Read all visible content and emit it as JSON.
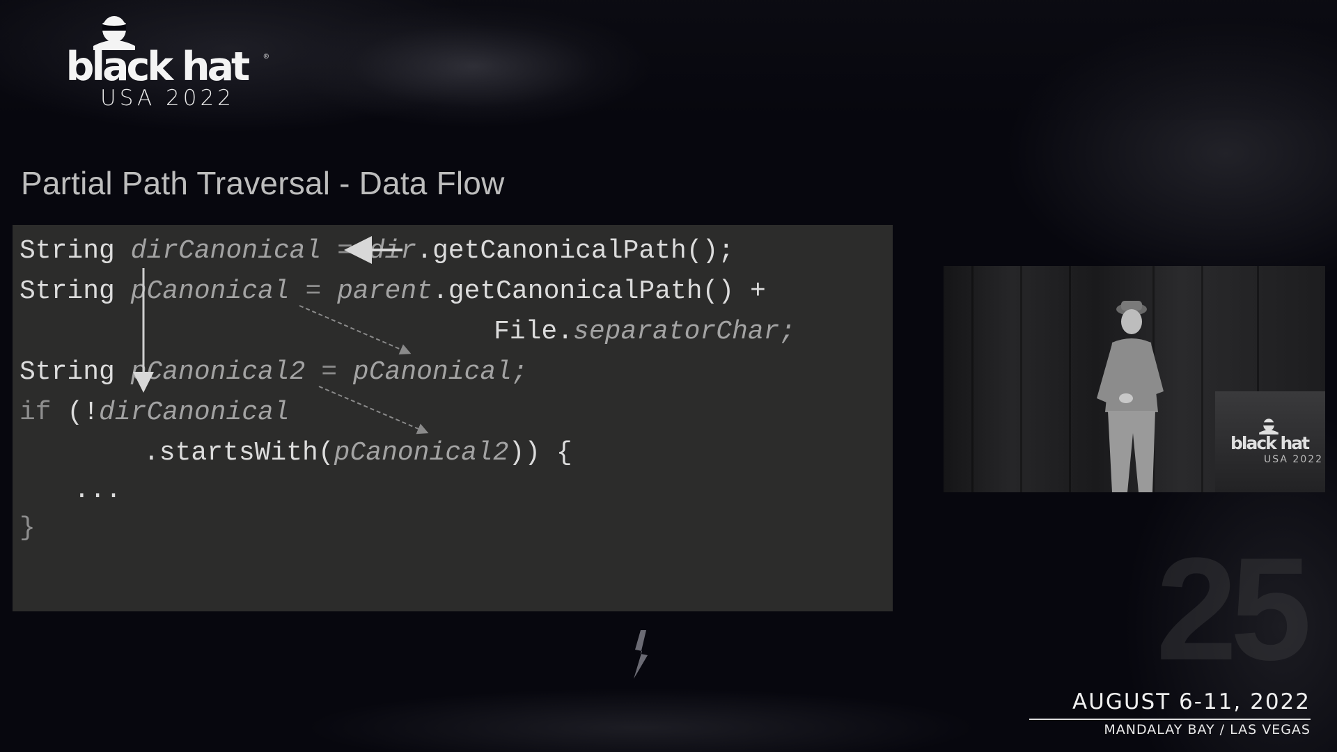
{
  "branding": {
    "wordmark": "black hat",
    "registered": "®",
    "edition": "USA 2022"
  },
  "slide": {
    "title": "Partial Path Traversal - Data Flow",
    "code": {
      "line1": {
        "kw": "String ",
        "var": "dirCanonical",
        "mid": " = ",
        "recv": "dir",
        "call": ".getCanonicalPath();"
      },
      "line2": {
        "kw": "String ",
        "var": "pCanonical",
        "mid": " = ",
        "recv": "parent",
        "call": ".getCanonicalPath() +"
      },
      "line3": {
        "cls": "File.",
        "field": "separatorChar;"
      },
      "line4": {
        "kw": "String ",
        "var": "pCanonical2",
        "mid": " = ",
        "rhs": "pCanonical;"
      },
      "line5": {
        "kw": "if ",
        "open": "(!",
        "var": "dirCanonical"
      },
      "line6": {
        "call": ".startsWith(",
        "arg": "pCanonical2",
        "close": ")) {"
      },
      "line7": {
        "body": "..."
      },
      "line8": {
        "close": "}"
      }
    }
  },
  "speaker_feed": {
    "podium_wordmark": "black hat",
    "podium_edition": "USA 2022"
  },
  "event": {
    "dates": "AUGUST 6-11, 2022",
    "venue": "MANDALAY BAY / LAS VEGAS"
  },
  "colors": {
    "background": "#07070e",
    "code_panel": "#2c2c2b",
    "text_light": "#dcdcdc",
    "italic_var": "#a3a3a3"
  }
}
